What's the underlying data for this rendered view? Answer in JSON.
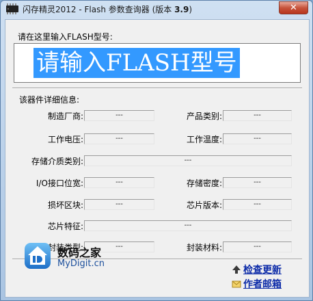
{
  "window": {
    "title": "闪存精灵2012 - Flash 参数查询器 (版本 ",
    "version": "3.9",
    "title_close": ")",
    "close_glyph": "✕"
  },
  "input": {
    "label": "请在这里输入FLASH型号:",
    "value": "请输入FLASH型号"
  },
  "details": {
    "title": "该器件详细信息:",
    "fields": {
      "manufacturer": {
        "label": "制造厂商:",
        "value": "---"
      },
      "product_category": {
        "label": "产品类别:",
        "value": "---"
      },
      "voltage": {
        "label": "工作电压:",
        "value": "---"
      },
      "temperature": {
        "label": "工作温度:",
        "value": "---"
      },
      "storage_medium": {
        "label": "存储介质类别:",
        "value": "---"
      },
      "io_width": {
        "label": "I/O接口位宽:",
        "value": "---"
      },
      "density": {
        "label": "存储密度:",
        "value": "---"
      },
      "bad_blocks": {
        "label": "损坏区块:",
        "value": "---"
      },
      "chip_version": {
        "label": "芯片版本:",
        "value": "---"
      },
      "chip_features": {
        "label": "芯片特征:",
        "value": "---"
      },
      "package_type": {
        "label": "封装类型:",
        "value": "---"
      },
      "package_material": {
        "label": "封装材料:",
        "value": "---"
      }
    }
  },
  "footer": {
    "brand_cn": "数码之家",
    "brand_en": "MyDigit.cn",
    "check_update": "检查更新",
    "author_email": "作者邮箱"
  },
  "colors": {
    "selection": "#3399ff",
    "link": "#0b2aa8",
    "brand_blue": "#1c4f9c",
    "close_red": "#c7543c"
  },
  "icons": {
    "app": "chip-icon",
    "logo": "mydigit-logo-icon",
    "update": "arrow-up-icon",
    "email": "envelope-icon"
  }
}
